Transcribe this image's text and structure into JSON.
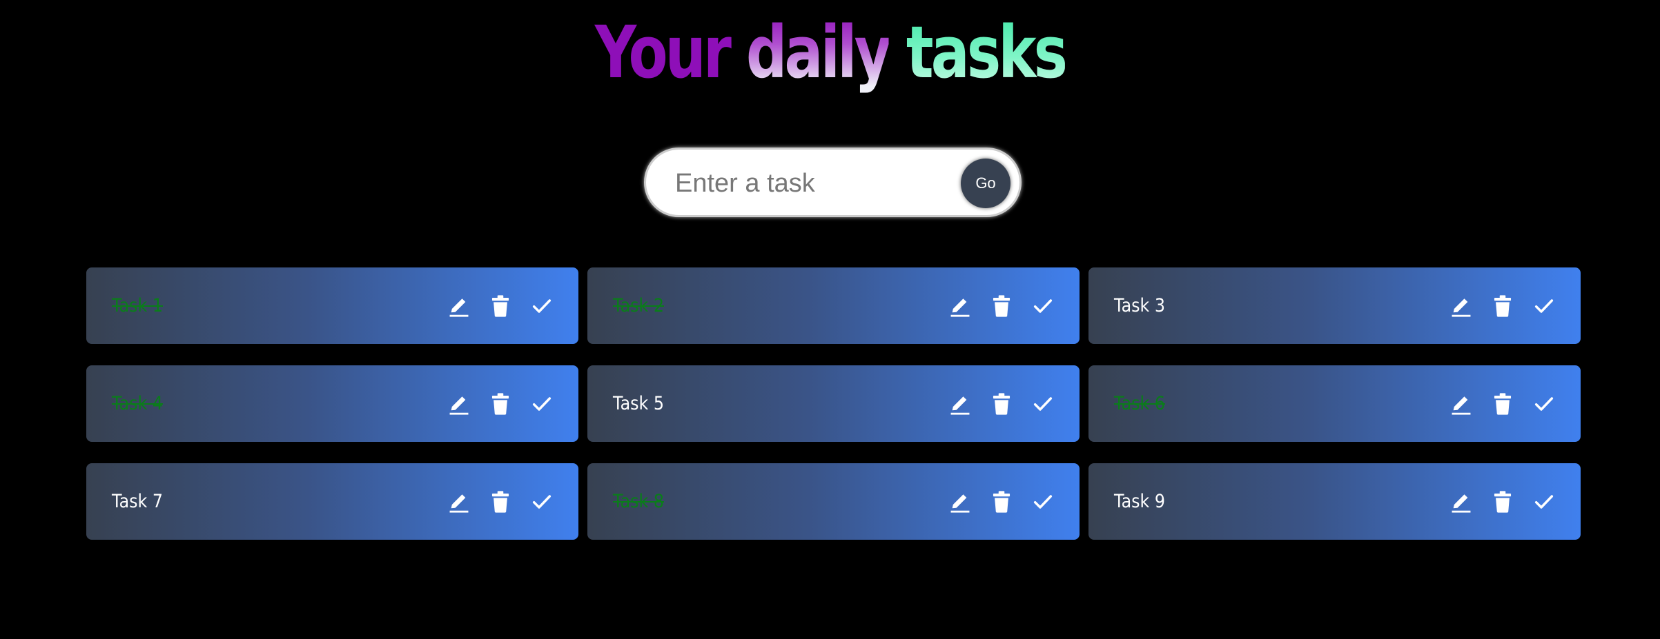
{
  "header": {
    "title_words": [
      "Your",
      "daily",
      "tasks"
    ]
  },
  "form": {
    "placeholder": "Enter a task",
    "value": "",
    "submit_label": "Go"
  },
  "colors": {
    "background": "#000000",
    "card_gradient_start": "#374151",
    "card_gradient_end": "#4080ee",
    "completed_text": "#0a7d1a",
    "title_word_1": "#8e0fb8",
    "title_word_3": "#3fe7a6"
  },
  "icons": {
    "edit": "pencil-icon",
    "delete": "trash-icon",
    "complete": "check-icon"
  },
  "tasks": [
    {
      "text": "Task 1",
      "completed": true
    },
    {
      "text": "Task 2",
      "completed": true
    },
    {
      "text": "Task 3",
      "completed": false
    },
    {
      "text": "Task 4",
      "completed": true
    },
    {
      "text": "Task 5",
      "completed": false
    },
    {
      "text": "Task 6",
      "completed": true
    },
    {
      "text": "Task 7",
      "completed": false
    },
    {
      "text": "Task 8",
      "completed": true
    },
    {
      "text": "Task 9",
      "completed": false
    }
  ]
}
